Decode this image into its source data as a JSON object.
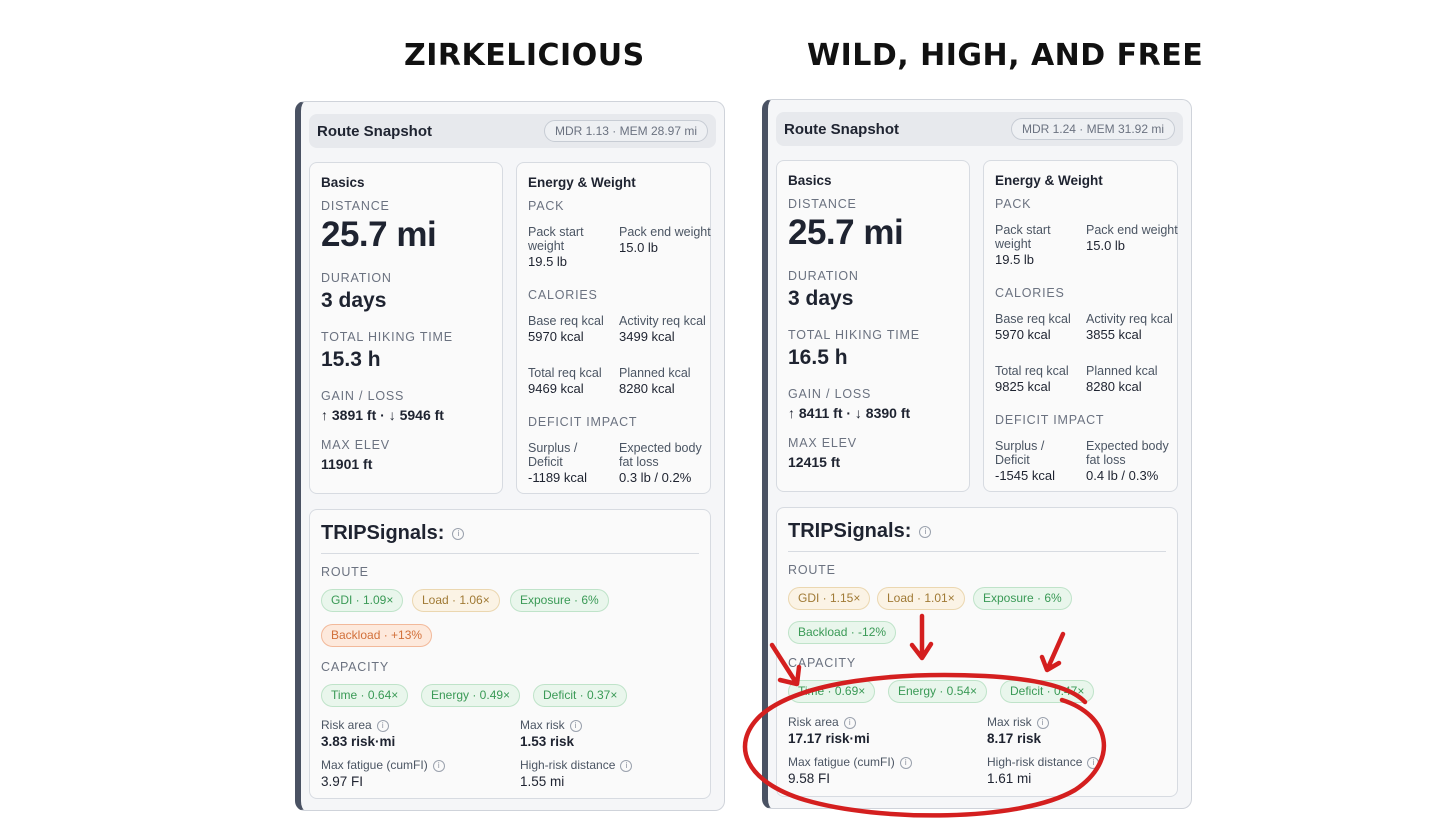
{
  "headings": {
    "left": "ZIRKELICIOUS",
    "right": "WILD, HIGH, AND FREE"
  },
  "common": {
    "snapshot_title": "Route Snapshot",
    "basics_title": "Basics",
    "distance_label": "DISTANCE",
    "duration_label": "DURATION",
    "hiking_time_label": "TOTAL HIKING TIME",
    "gain_loss_label": "GAIN / LOSS",
    "max_elev_label": "MAX ELEV",
    "energy_title": "Energy & Weight",
    "pack_label": "PACK",
    "pack_start_label": "Pack start weight",
    "pack_end_label": "Pack end weight",
    "calories_label": "CALORIES",
    "base_req_label": "Base req kcal",
    "activity_req_label": "Activity req kcal",
    "total_req_label": "Total req kcal",
    "planned_label": "Planned kcal",
    "deficit_impact_label": "DEFICIT IMPACT",
    "surplus_label": "Surplus / Deficit",
    "fat_loss_label": "Expected body fat loss",
    "trip_title": "TRIPSignals:",
    "info_glyph": "i",
    "route_label": "ROUTE",
    "capacity_label": "CAPACITY",
    "risk_area_label": "Risk area",
    "max_risk_label": "Max risk",
    "max_fatigue_label": "Max fatigue (cumFI)",
    "high_risk_label": "High-risk distance"
  },
  "left": {
    "badge": "MDR 1.13 · MEM 28.97 mi",
    "distance": "25.7 mi",
    "duration": "3 days",
    "hiking_time": "15.3 h",
    "gain_loss": "↑ 3891 ft · ↓ 5946 ft",
    "max_elev": "11901 ft",
    "pack_start": "19.5 lb",
    "pack_end": "15.0 lb",
    "base_req": "5970 kcal",
    "activity_req": "3499 kcal",
    "total_req": "9469 kcal",
    "planned": "8280 kcal",
    "surplus": "-1189 kcal",
    "fat_loss": "0.3 lb / 0.2%",
    "chips_route": [
      "GDI · 1.09×",
      "Load · 1.06×",
      "Exposure · 6%",
      "Backload · +13%"
    ],
    "chips_capacity": [
      "Time · 0.64×",
      "Energy · 0.49×",
      "Deficit · 0.37×"
    ],
    "risk_area": "3.83 risk·mi",
    "max_risk": "1.53 risk",
    "max_fatigue": "3.97 FI",
    "high_risk": "1.55 mi"
  },
  "right": {
    "badge": "MDR 1.24 · MEM 31.92 mi",
    "distance": "25.7 mi",
    "duration": "3 days",
    "hiking_time": "16.5 h",
    "gain_loss": "↑ 8411 ft · ↓ 8390 ft",
    "max_elev": "12415 ft",
    "pack_start": "19.5 lb",
    "pack_end": "15.0 lb",
    "base_req": "5970 kcal",
    "activity_req": "3855 kcal",
    "total_req": "9825 kcal",
    "planned": "8280 kcal",
    "surplus": "-1545 kcal",
    "fat_loss": "0.4 lb / 0.3%",
    "chips_route": [
      "GDI · 1.15×",
      "Load · 1.01×",
      "Exposure · 6%",
      "Backload · -12%"
    ],
    "chips_capacity": [
      "Time · 0.69×",
      "Energy · 0.54×",
      "Deficit · 0.47×"
    ],
    "risk_area": "17.17 risk·mi",
    "max_risk": "8.17 risk",
    "max_fatigue": "9.58 FI",
    "high_risk": "1.61 mi"
  },
  "colors": {
    "chip_green": "#3a9a56",
    "chip_amber": "#a07a35",
    "chip_orange": "#d2703a",
    "annotation_red": "#d41f1f",
    "panel_accent": "#4a5263"
  }
}
